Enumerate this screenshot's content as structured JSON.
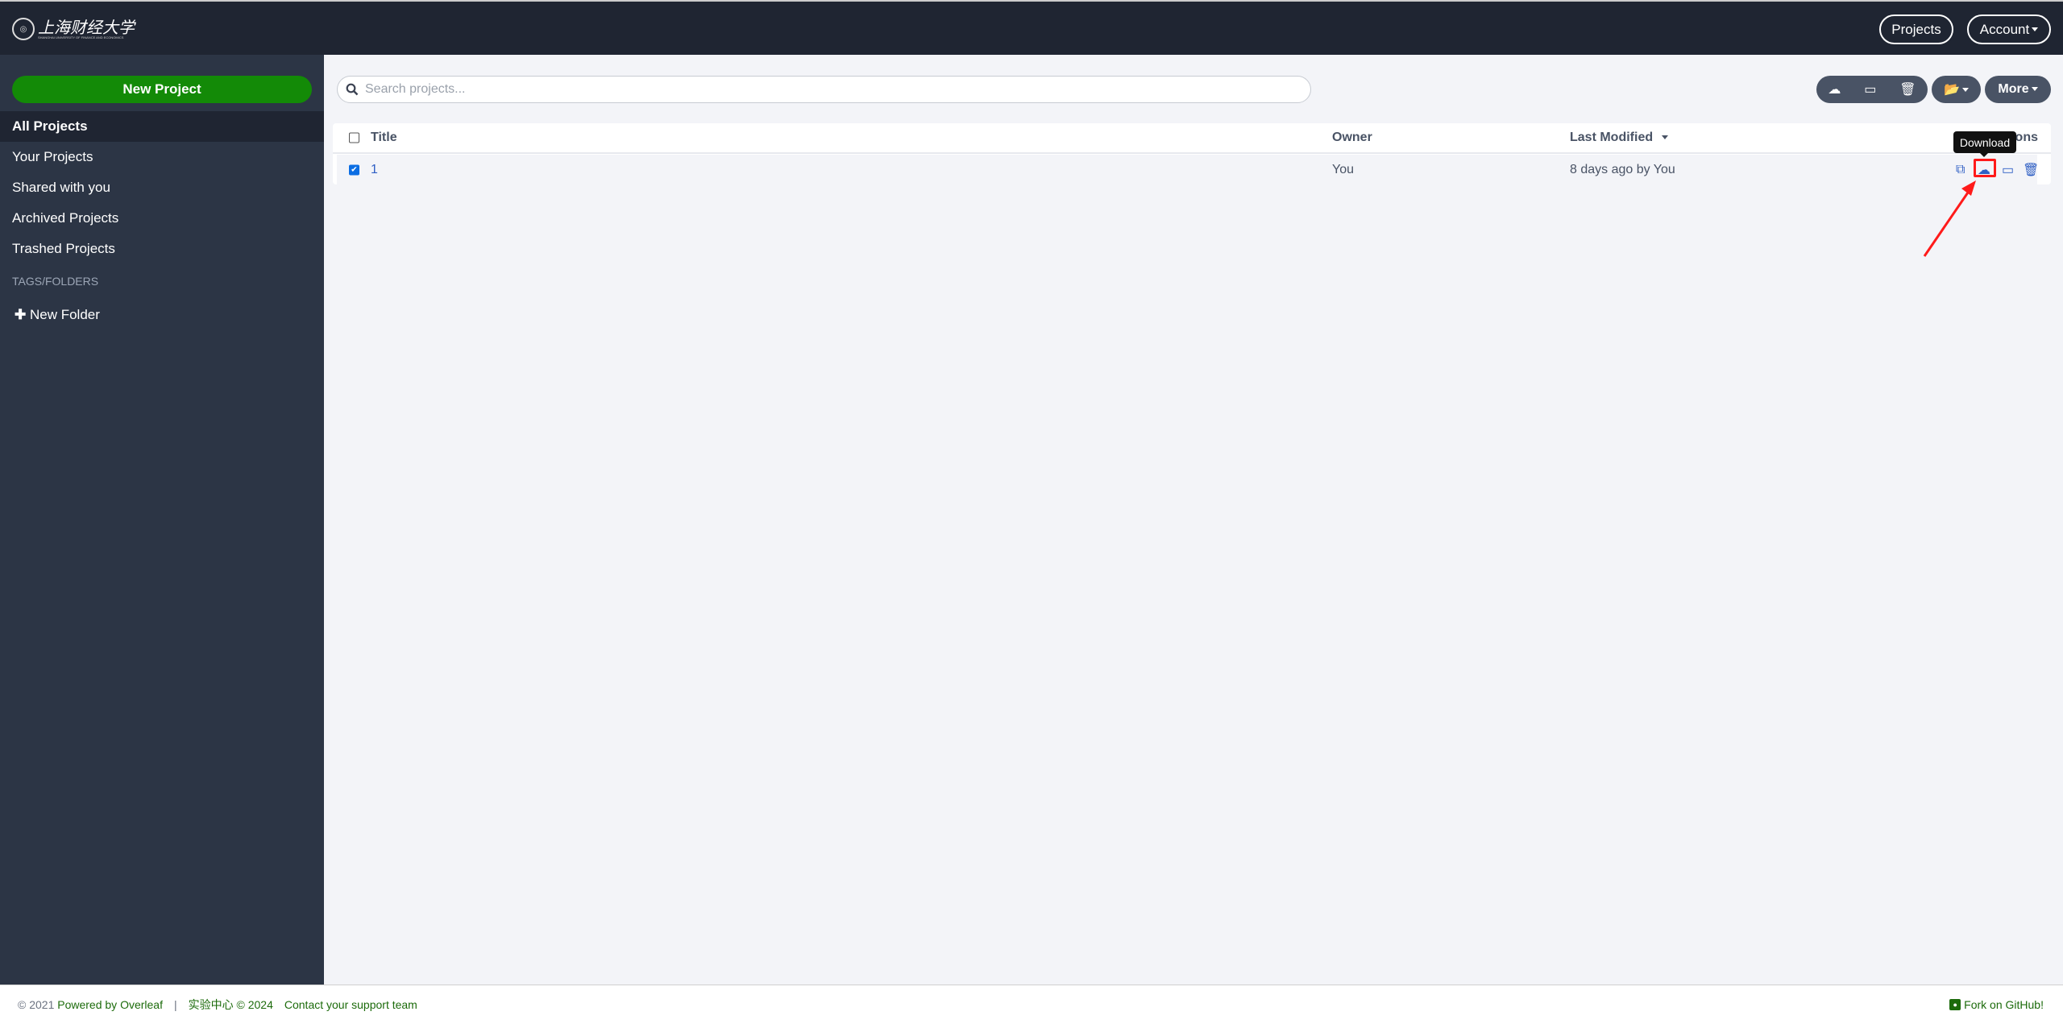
{
  "header": {
    "logo_text": "上海财经大学",
    "logo_subtext": "SHANGHAI UNIVERSITY OF FINANCE AND ECONOMICS",
    "projects_label": "Projects",
    "account_label": "Account"
  },
  "sidebar": {
    "new_project_label": "New Project",
    "items": [
      {
        "label": "All Projects",
        "active": true
      },
      {
        "label": "Your Projects"
      },
      {
        "label": "Shared with you"
      },
      {
        "label": "Archived Projects"
      },
      {
        "label": "Trashed Projects"
      }
    ],
    "tags_heading": "TAGS/FOLDERS",
    "new_folder_label": "New Folder"
  },
  "main": {
    "search": {
      "placeholder": "Search projects...",
      "value": ""
    },
    "toolbar": {
      "icons": [
        "cloud-download-icon",
        "archive-icon",
        "trash-icon",
        "folder-open-icon"
      ],
      "more_label": "More"
    },
    "table": {
      "columns": [
        "Title",
        "Owner",
        "Last Modified",
        "Actions"
      ],
      "sort_column": "Last Modified",
      "rows": [
        {
          "title": "1",
          "owner": "You",
          "last_modified": "8 days ago by You",
          "checked": true,
          "actions": [
            "copy-icon",
            "cloud-download-icon",
            "archive-icon",
            "trash-icon"
          ]
        }
      ]
    },
    "tooltip": "Download"
  },
  "colors": {
    "header_bg": "#1f2532",
    "sidebar_bg": "#2c3545",
    "new_project_green": "#138a07",
    "highlight_red": "#ff1a1a",
    "action_blue": "#2f5fc4"
  },
  "footer": {
    "copyright_prefix": "© 2021",
    "powered_by": "Powered by Overleaf",
    "separator": "|",
    "lab_center": "实验中心",
    "copyright_2024": "© 2024",
    "contact": "Contact your support team",
    "github": "Fork on GitHub!"
  }
}
